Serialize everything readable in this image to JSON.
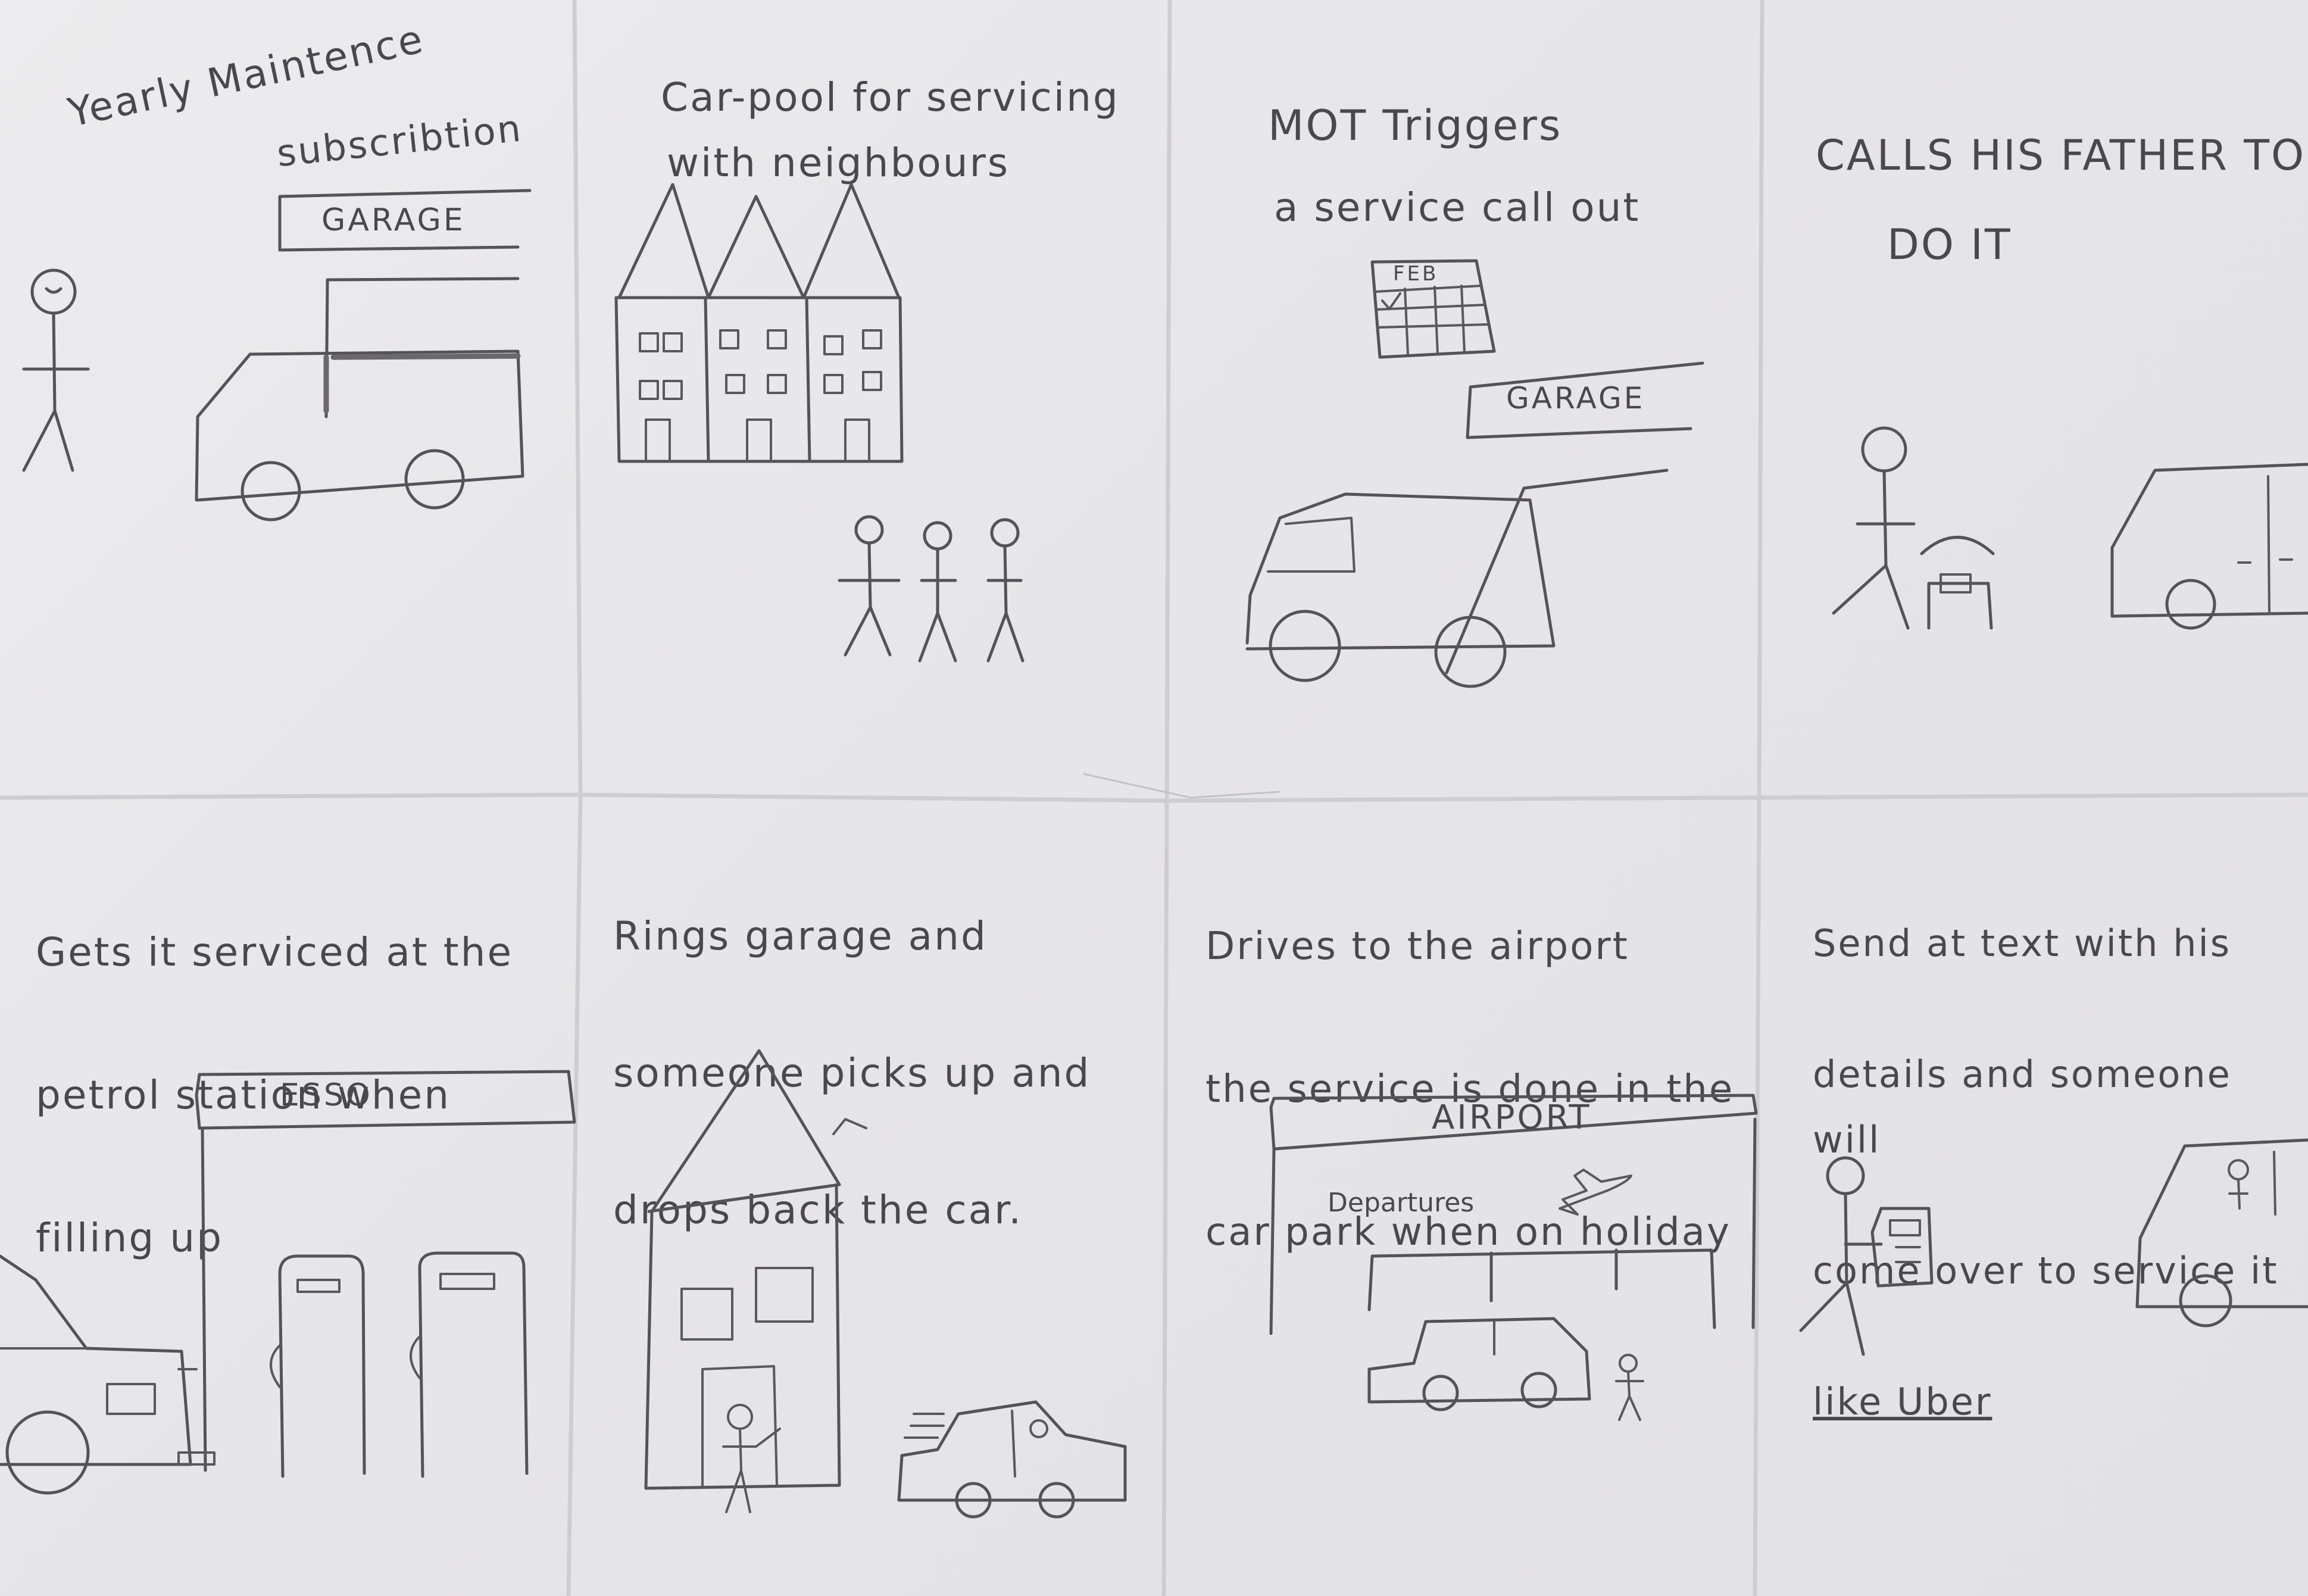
{
  "panels": [
    {
      "caption_lines": [
        "Yearly Maintence",
        "subscribtion"
      ],
      "sign": "GARAGE"
    },
    {
      "caption_lines": [
        "Car-pool for servicing",
        "with neighbours"
      ]
    },
    {
      "caption_lines": [
        "MOT Triggers",
        "a service call out"
      ],
      "calendar_label": "FEB",
      "sign": "GARAGE"
    },
    {
      "caption_lines": [
        "CALLS HIS FATHER TO",
        "DO IT"
      ]
    },
    {
      "caption_lines": [
        "Gets it serviced at the",
        "petrol station when",
        "filling up"
      ],
      "sign": "ESSO"
    },
    {
      "caption_lines": [
        "Rings garage and",
        "someone picks up and",
        "drops back the car."
      ]
    },
    {
      "caption_lines": [
        "Drives to the airport",
        "the service is done in the",
        "car park when on holiday"
      ],
      "sign": "AIRPORT",
      "sub_sign": "Departures"
    },
    {
      "caption_lines": [
        "Send at text with his",
        "details and someone will",
        "come over to service it",
        "like Uber"
      ]
    }
  ],
  "colors": {
    "paper": "#e9e8ea",
    "pencil": "#555258",
    "crease": "#cfcdd2"
  }
}
